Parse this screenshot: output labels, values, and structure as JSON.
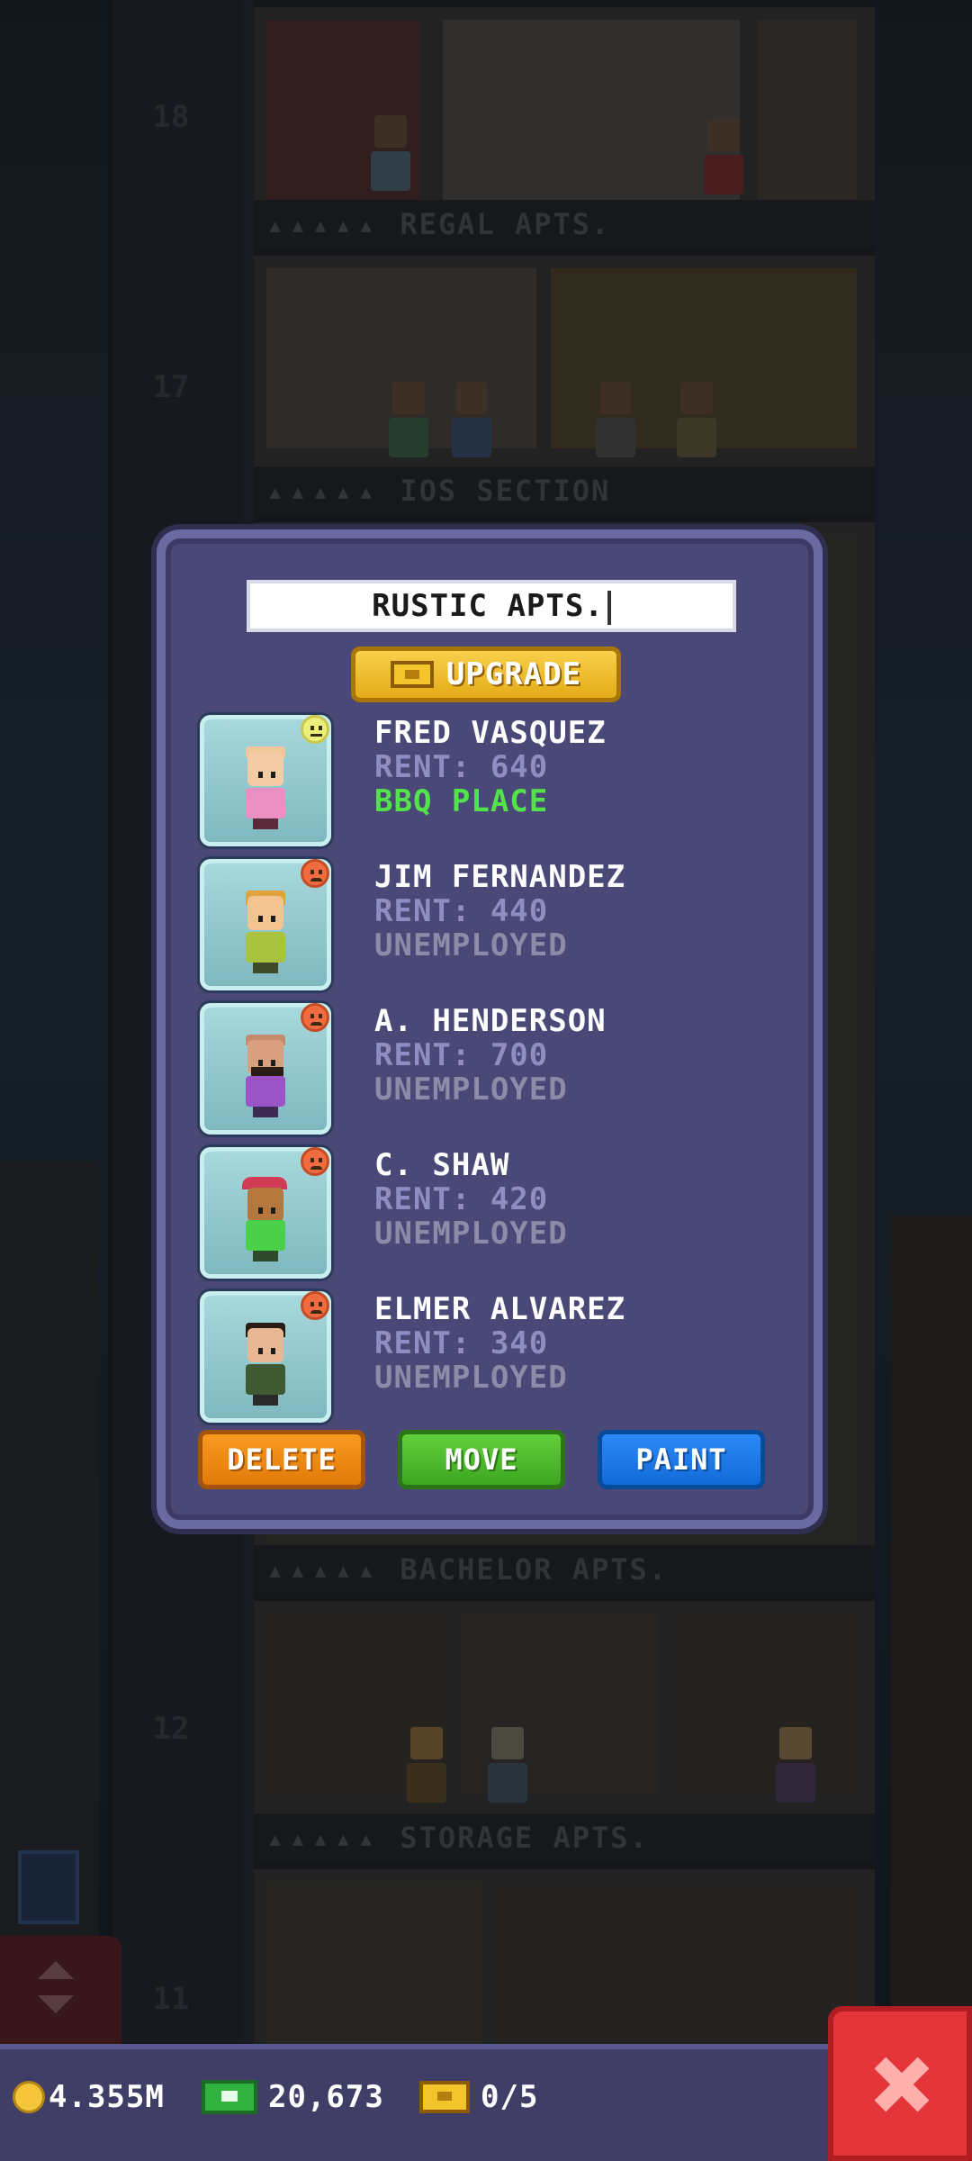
{
  "background": {
    "floors": [
      {
        "number": "18",
        "label": "REGAL APTS."
      },
      {
        "number": "17",
        "label": "IOS SECTION"
      },
      {
        "number": "",
        "label": "BACHELOR APTS."
      },
      {
        "number": "12",
        "label": "STORAGE APTS."
      },
      {
        "number": "11",
        "label": ""
      }
    ],
    "label_dots": "▴▴▴▴▴"
  },
  "dialog": {
    "name_value": "RUSTIC APTS.",
    "upgrade_label": "UPGRADE",
    "upgrade_icon": "bux-icon",
    "tenants": [
      {
        "name": "FRED VASQUEZ",
        "rent": "RENT: 640",
        "job": "BBQ PLACE",
        "mood": "neutral",
        "employed": true
      },
      {
        "name": "JIM FERNANDEZ",
        "rent": "RENT: 440",
        "job": "UNEMPLOYED",
        "mood": "sad",
        "employed": false
      },
      {
        "name": "A. HENDERSON",
        "rent": "RENT: 700",
        "job": "UNEMPLOYED",
        "mood": "sad",
        "employed": false
      },
      {
        "name": "C. SHAW",
        "rent": "RENT: 420",
        "job": "UNEMPLOYED",
        "mood": "sad",
        "employed": false
      },
      {
        "name": "ELMER ALVAREZ",
        "rent": "RENT: 340",
        "job": "UNEMPLOYED",
        "mood": "sad",
        "employed": false
      }
    ],
    "buttons": {
      "delete": "DELETE",
      "move": "MOVE",
      "paint": "PAINT"
    }
  },
  "status_bar": {
    "coins": "4.355M",
    "cash": "20,673",
    "bux": "0/5"
  },
  "colors": {
    "dialog_bg": "#4a4877",
    "employed_text": "#53e34b",
    "unemployed_text": "#8e8ba8",
    "delete_button": "#f08a14",
    "move_button": "#4fbb2e",
    "paint_button": "#1e7ae6",
    "close_button": "#e3353a"
  }
}
